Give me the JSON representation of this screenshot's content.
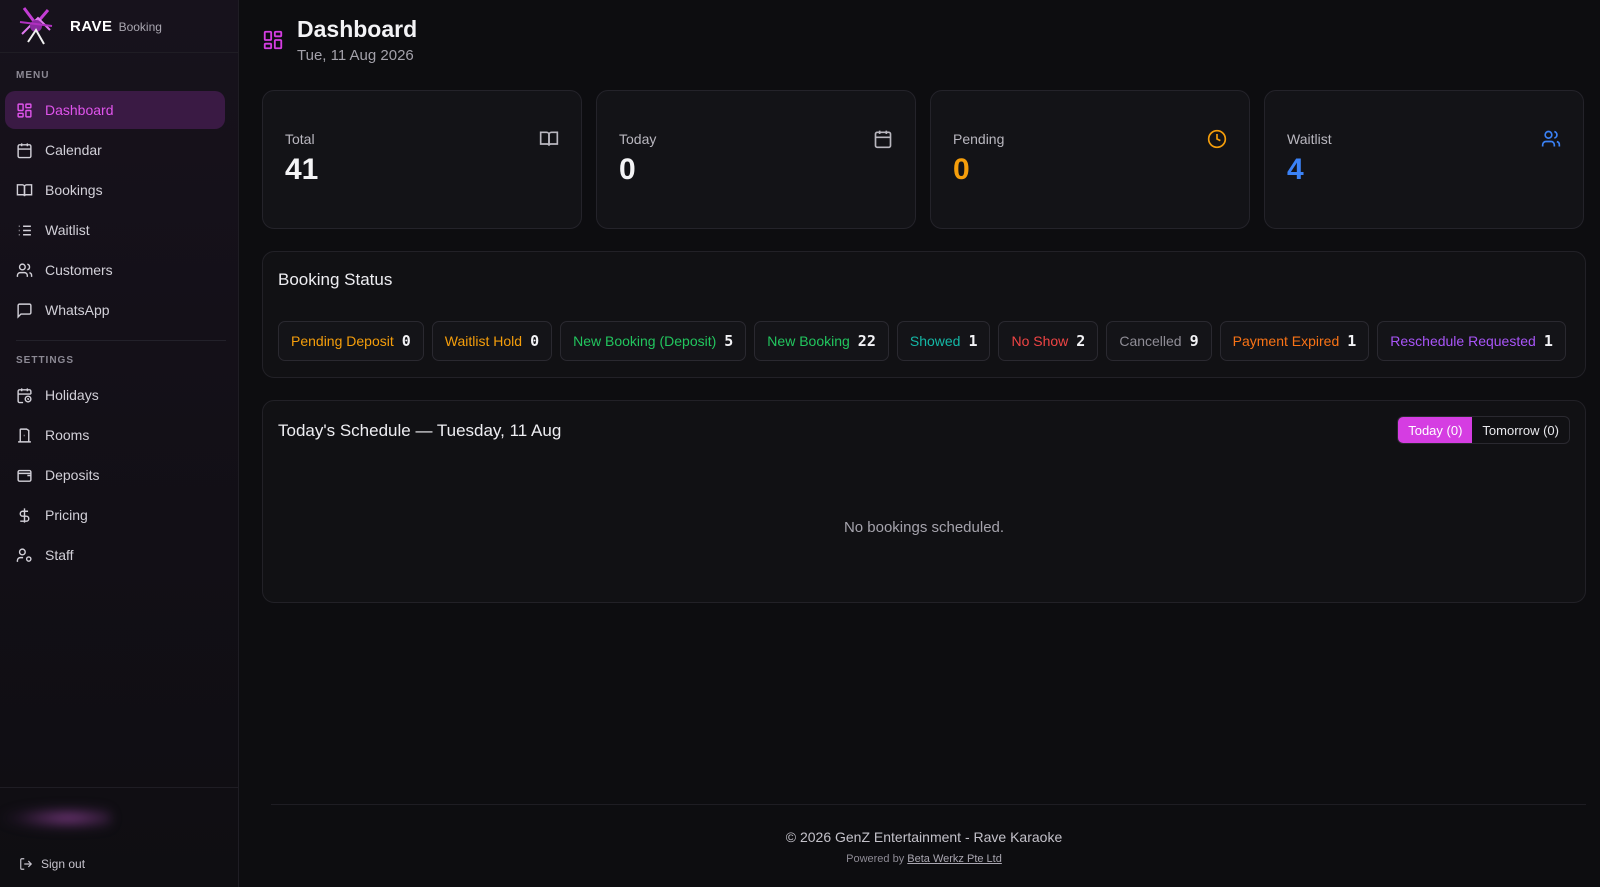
{
  "brand": {
    "name": "RAVE",
    "sub": "Booking"
  },
  "sidebar": {
    "menu_label": "MENU",
    "menu_items": [
      {
        "label": "Dashboard",
        "icon": "dashboard-icon",
        "active": true
      },
      {
        "label": "Calendar",
        "icon": "calendar-icon"
      },
      {
        "label": "Bookings",
        "icon": "book-icon"
      },
      {
        "label": "Waitlist",
        "icon": "list-icon"
      },
      {
        "label": "Customers",
        "icon": "users-icon"
      },
      {
        "label": "WhatsApp",
        "icon": "message-icon"
      }
    ],
    "settings_label": "SETTINGS",
    "settings_items": [
      {
        "label": "Holidays",
        "icon": "calendar-clock-icon"
      },
      {
        "label": "Rooms",
        "icon": "door-icon"
      },
      {
        "label": "Deposits",
        "icon": "wallet-icon"
      },
      {
        "label": "Pricing",
        "icon": "dollar-icon"
      },
      {
        "label": "Staff",
        "icon": "user-cog-icon"
      }
    ],
    "sign_out": "Sign out"
  },
  "header": {
    "title": "Dashboard",
    "date": "Tue, 11 Aug 2026"
  },
  "stats": [
    {
      "label": "Total",
      "value": "41",
      "icon": "book-open-icon",
      "color": "#f4f4f6",
      "icon_color": "#b9b7bf"
    },
    {
      "label": "Today",
      "value": "0",
      "icon": "calendar-icon",
      "color": "#f4f4f6",
      "icon_color": "#b9b7bf"
    },
    {
      "label": "Pending",
      "value": "0",
      "icon": "clock-icon",
      "color": "#f59e0b",
      "icon_color": "#f59e0b"
    },
    {
      "label": "Waitlist",
      "value": "4",
      "icon": "users-icon",
      "color": "#3b82f6",
      "icon_color": "#3b82f6"
    }
  ],
  "booking_status": {
    "title": "Booking Status",
    "items": [
      {
        "label": "Pending Deposit",
        "count": "0",
        "color": "#f59e0b"
      },
      {
        "label": "Waitlist Hold",
        "count": "0",
        "color": "#f59e0b"
      },
      {
        "label": "New Booking (Deposit)",
        "count": "5",
        "color": "#22c55e"
      },
      {
        "label": "New Booking",
        "count": "22",
        "color": "#22c55e"
      },
      {
        "label": "Showed",
        "count": "1",
        "color": "#14b8a6"
      },
      {
        "label": "No Show",
        "count": "2",
        "color": "#ef4444"
      },
      {
        "label": "Cancelled",
        "count": "9",
        "color": "#8f8d96"
      },
      {
        "label": "Payment Expired",
        "count": "1",
        "color": "#f97316"
      },
      {
        "label": "Reschedule Requested",
        "count": "1",
        "color": "#a855f7"
      }
    ]
  },
  "schedule": {
    "title": "Today's Schedule — Tuesday, 11 Aug",
    "tab_today": "Today (0)",
    "tab_tomorrow": "Tomorrow (0)",
    "empty": "No bookings scheduled."
  },
  "footer": {
    "copyright": "© 2026 GenZ Entertainment - Rave Karaoke",
    "powered_prefix": "Powered by",
    "powered_link": "Beta Werkz Pte Ltd"
  },
  "colors": {
    "accent": "#d53de2",
    "background": "#0d0d10"
  }
}
